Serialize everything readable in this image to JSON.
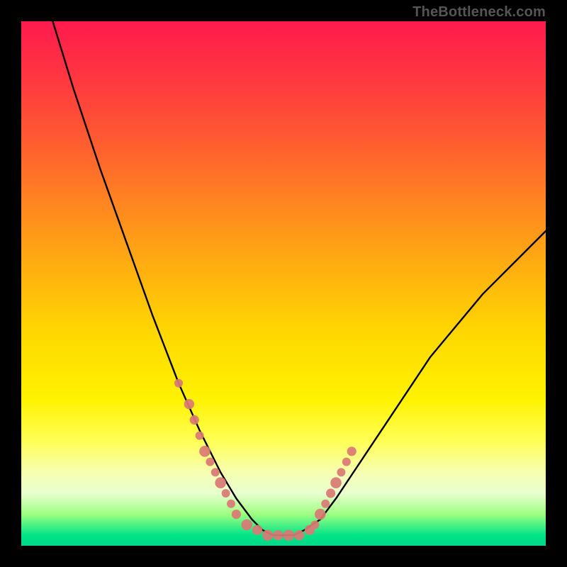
{
  "watermark": "TheBottleneck.com",
  "chart_data": {
    "type": "line",
    "title": "",
    "xlabel": "",
    "ylabel": "",
    "xlim": [
      0,
      100
    ],
    "ylim": [
      0,
      100
    ],
    "grid": false,
    "legend": false,
    "series": [
      {
        "name": "curve",
        "x": [
          6,
          10,
          15,
          20,
          25,
          30,
          34,
          38,
          41,
          44,
          46,
          48,
          50,
          52,
          54,
          57,
          60,
          64,
          70,
          78,
          88,
          100
        ],
        "y": [
          100,
          87,
          72,
          58,
          44,
          31,
          22,
          14,
          9,
          5,
          3,
          2,
          2,
          2,
          3,
          5,
          9,
          15,
          24,
          36,
          48,
          60
        ]
      }
    ],
    "markers": {
      "name": "beads",
      "color": "#d97a74",
      "points": [
        {
          "x": 30,
          "y": 31,
          "r": 1.0
        },
        {
          "x": 32,
          "y": 27,
          "r": 1.2
        },
        {
          "x": 33,
          "y": 24,
          "r": 1.1
        },
        {
          "x": 34,
          "y": 21,
          "r": 1.0
        },
        {
          "x": 35,
          "y": 18,
          "r": 1.3
        },
        {
          "x": 36,
          "y": 16,
          "r": 1.0
        },
        {
          "x": 37,
          "y": 14,
          "r": 1.0
        },
        {
          "x": 38,
          "y": 12,
          "r": 1.3
        },
        {
          "x": 39,
          "y": 10,
          "r": 1.0
        },
        {
          "x": 40,
          "y": 8,
          "r": 1.0
        },
        {
          "x": 41,
          "y": 6,
          "r": 1.1
        },
        {
          "x": 43,
          "y": 4,
          "r": 1.3
        },
        {
          "x": 45,
          "y": 3,
          "r": 1.2
        },
        {
          "x": 47,
          "y": 2,
          "r": 1.3
        },
        {
          "x": 49,
          "y": 2,
          "r": 1.2
        },
        {
          "x": 51,
          "y": 2,
          "r": 1.3
        },
        {
          "x": 53,
          "y": 2,
          "r": 1.2
        },
        {
          "x": 55,
          "y": 3,
          "r": 1.2
        },
        {
          "x": 56,
          "y": 4,
          "r": 1.0
        },
        {
          "x": 57,
          "y": 6,
          "r": 1.3
        },
        {
          "x": 58,
          "y": 8,
          "r": 1.0
        },
        {
          "x": 59,
          "y": 10,
          "r": 1.1
        },
        {
          "x": 60,
          "y": 12,
          "r": 1.3
        },
        {
          "x": 61,
          "y": 14,
          "r": 1.0
        },
        {
          "x": 62,
          "y": 16,
          "r": 1.0
        },
        {
          "x": 63,
          "y": 18,
          "r": 1.1
        }
      ]
    },
    "background_gradient": {
      "top": "#ff1a4d",
      "bottom": "#00d989"
    }
  }
}
